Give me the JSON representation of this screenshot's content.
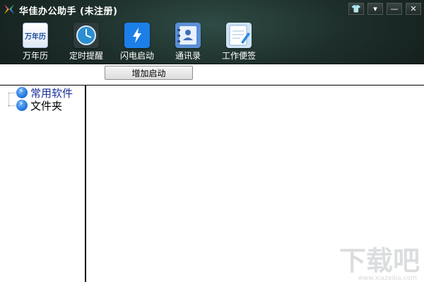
{
  "app": {
    "title": "华佳办公助手 (未注册)"
  },
  "window_controls": [
    {
      "name": "skin-icon",
      "glyph": "👕"
    },
    {
      "name": "menu-icon",
      "glyph": "▾"
    },
    {
      "name": "minimize-icon",
      "glyph": "—"
    },
    {
      "name": "close-icon",
      "glyph": "✕"
    }
  ],
  "toolbar": {
    "items": [
      {
        "label": "万年历",
        "icon": "calendar-icon",
        "icon_text": "万年历"
      },
      {
        "label": "定时提醒",
        "icon": "clock-icon"
      },
      {
        "label": "闪电启动",
        "icon": "lightning-icon"
      },
      {
        "label": "通讯录",
        "icon": "contacts-icon"
      },
      {
        "label": "工作便签",
        "icon": "notepad-icon"
      }
    ]
  },
  "actions": {
    "add_launch": "增加启动"
  },
  "tree": {
    "items": [
      {
        "label": "常用软件",
        "selected": true
      },
      {
        "label": "文件夹",
        "selected": false
      }
    ]
  },
  "watermark": {
    "text": "下载吧",
    "url": "www.xiazaiba.com"
  },
  "colors": {
    "header_dark": "#101816",
    "header_mid": "#2f4b45",
    "accent_blue": "#1e6fd9",
    "selected_text": "#1a2f9a"
  }
}
